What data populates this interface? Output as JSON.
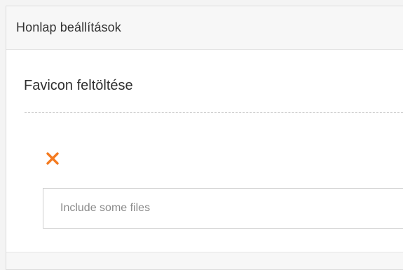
{
  "panel": {
    "title": "Honlap beállítások"
  },
  "section": {
    "title": "Favicon feltöltése"
  },
  "upload": {
    "placeholder": "Include some files",
    "remove_icon": "close-icon"
  },
  "colors": {
    "accent": "#f47b20",
    "background": "#f4f4f4",
    "panel_header": "#f7f7f7",
    "text": "#333333",
    "placeholder": "#8a8a8a"
  }
}
